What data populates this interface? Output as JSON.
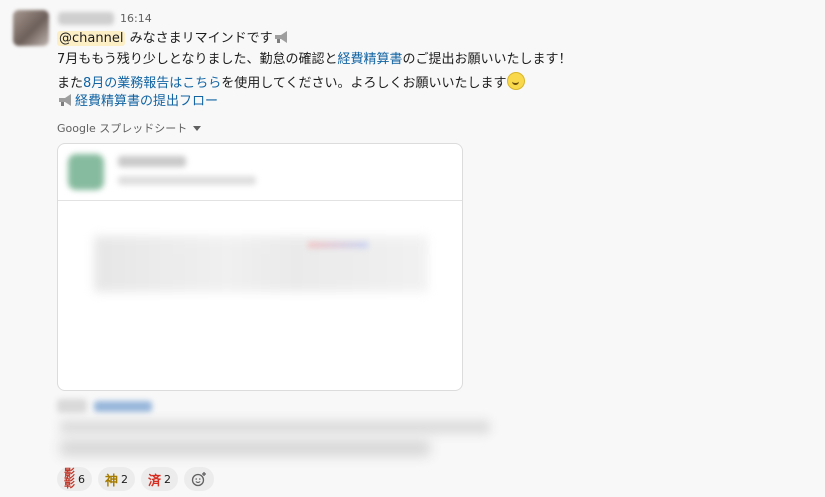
{
  "message": {
    "time": "16:14",
    "line1": {
      "mention": "@channel",
      "text": " みなさまリマインドです"
    },
    "line2": {
      "pre": "7月ももう残り少しとなりました、勤怠の確認と",
      "link": "経費精算書",
      "post": "のご提出お願いいたします！"
    },
    "line3": {
      "pre": "また",
      "link": "8月の業務報告はこちら",
      "post": "を使用してください。よろしくお願いいたします"
    },
    "line4": {
      "link": "経費精算書の提出フロー"
    },
    "source_label": "Google スプレッドシート"
  },
  "reactions": [
    {
      "glyph": "影 ",
      "label": "彰",
      "count": "6",
      "color": "#c0392b"
    },
    {
      "glyph": "神",
      "count": "2",
      "color": "#a67c00"
    },
    {
      "glyph": "済",
      "count": "2",
      "color": "#d62d20"
    }
  ],
  "icons": {
    "megaphone": "megaphone-icon",
    "smile": "smiling-face-icon",
    "add_reaction": "add-reaction-icon",
    "caret": "chevron-down-icon"
  },
  "colors": {
    "link": "#1264a3",
    "mention_bg": "#fcefc6",
    "background": "#f8f8f8"
  }
}
